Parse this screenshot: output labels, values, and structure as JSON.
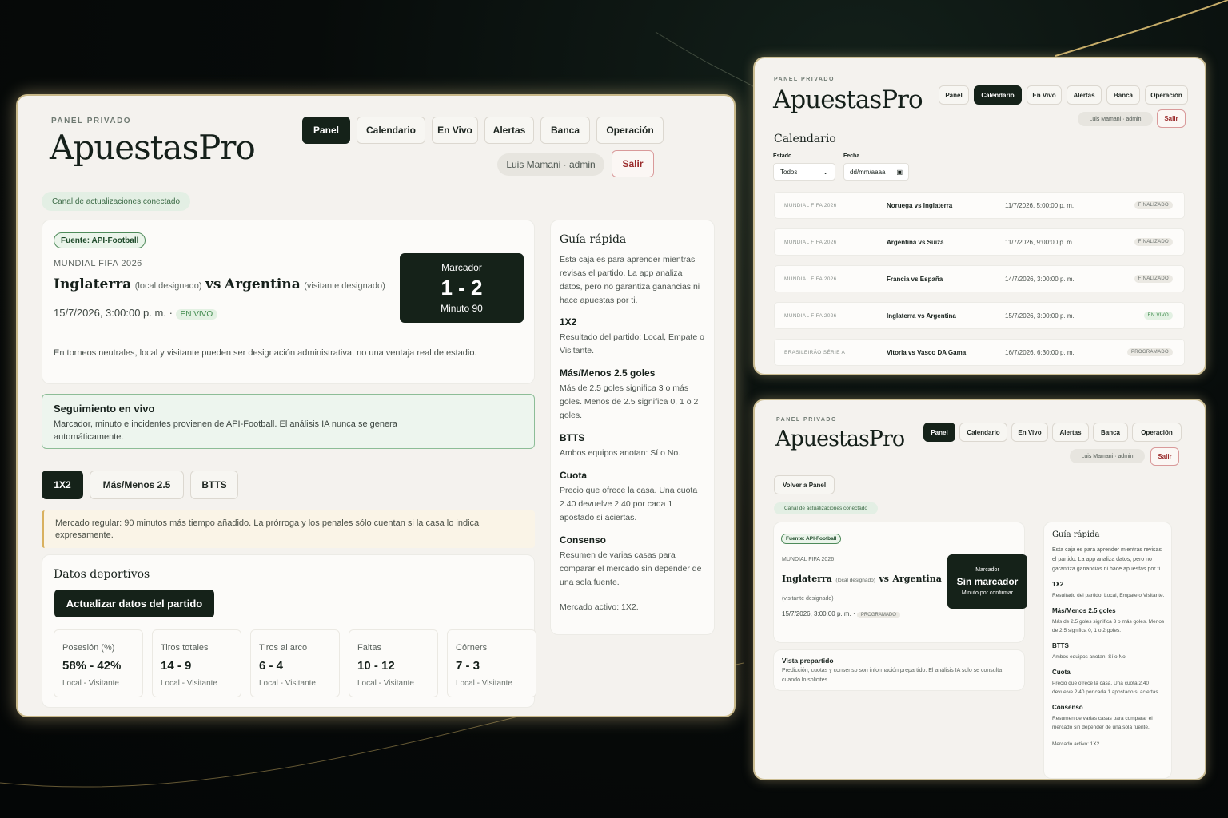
{
  "main": {
    "eyebrow": "PANEL PRIVADO",
    "brand": "ApuestasPro",
    "nav": [
      "Panel",
      "Calendario",
      "En Vivo",
      "Alertas",
      "Banca",
      "Operación"
    ],
    "user": "Luis Mamani · admin",
    "logout": "Salir",
    "status": "Canal de actualizaciones conectado",
    "source": "Fuente: API-Football",
    "competition": "MUNDIAL FIFA 2026",
    "home": "Inglaterra",
    "home_note": "(local designado)",
    "vs": "vs",
    "away": "Argentina",
    "away_note": "(visitante designado)",
    "datetime": "15/7/2026, 3:00:00 p. m.",
    "sep": "·",
    "state": "EN VIVO",
    "score_label": "Marcador",
    "score": "1 - 2",
    "minute": "Minuto 90",
    "neutral_note": "En torneos neutrales, local y visitante pueden ser designación administrativa, no una ventaja real de estadio.",
    "live_title": "Seguimiento en vivo",
    "live_text": "Marcador, minuto e incidentes provienen de API-Football. El análisis IA nunca se genera automáticamente.",
    "markets": [
      "1X2",
      "Más/Menos 2.5",
      "BTTS"
    ],
    "market_note": "Mercado regular: 90 minutos más tiempo añadido. La prórroga y los penales sólo cuentan si la casa lo indica expresamente.",
    "sports_title": "Datos deportivos",
    "update_btn": "Actualizar datos del partido",
    "stats": [
      {
        "label": "Posesión (%)",
        "value": "58% - 42%",
        "sub": "Local - Visitante"
      },
      {
        "label": "Tiros totales",
        "value": "14 - 9",
        "sub": "Local - Visitante"
      },
      {
        "label": "Tiros al arco",
        "value": "6 - 4",
        "sub": "Local - Visitante"
      },
      {
        "label": "Faltas",
        "value": "10 - 12",
        "sub": "Local - Visitante"
      },
      {
        "label": "Córners",
        "value": "7 - 3",
        "sub": "Local - Visitante"
      }
    ],
    "guide": {
      "title": "Guía rápida",
      "intro": "Esta caja es para aprender mientras revisas el partido. La app analiza datos, pero no garantiza ganancias ni hace apuestas por ti.",
      "items": [
        {
          "h": "1X2",
          "t": "Resultado del partido: Local, Empate o Visitante."
        },
        {
          "h": "Más/Menos 2.5 goles",
          "t": "Más de 2.5 goles significa 3 o más goles. Menos de 2.5 significa 0, 1 o 2 goles."
        },
        {
          "h": "BTTS",
          "t": "Ambos equipos anotan: Sí o No."
        },
        {
          "h": "Cuota",
          "t": "Precio que ofrece la casa. Una cuota 2.40 devuelve 2.40 por cada 1 apostado si aciertas."
        },
        {
          "h": "Consenso",
          "t": "Resumen de varias casas para comparar el mercado sin depender de una sola fuente."
        }
      ],
      "active": "Mercado activo: 1X2."
    }
  },
  "calendar": {
    "eyebrow": "PANEL PRIVADO",
    "brand": "ApuestasPro",
    "nav": [
      "Panel",
      "Calendario",
      "En Vivo",
      "Alertas",
      "Banca",
      "Operación"
    ],
    "user": "Luis Mamani · admin",
    "logout": "Salir",
    "title": "Calendario",
    "state_label": "Estado",
    "state_value": "Todos",
    "date_label": "Fecha",
    "date_placeholder": "dd/mm/aaaa",
    "rows": [
      {
        "comp": "MUNDIAL FIFA 2026",
        "match": "Noruega vs Inglaterra",
        "date": "11/7/2026, 5:00:00 p. m.",
        "status": "FINALIZADO"
      },
      {
        "comp": "MUNDIAL FIFA 2026",
        "match": "Argentina vs Suiza",
        "date": "11/7/2026, 9:00:00 p. m.",
        "status": "FINALIZADO"
      },
      {
        "comp": "MUNDIAL FIFA 2026",
        "match": "Francia vs España",
        "date": "14/7/2026, 3:00:00 p. m.",
        "status": "FINALIZADO"
      },
      {
        "comp": "MUNDIAL FIFA 2026",
        "match": "Inglaterra vs Argentina",
        "date": "15/7/2026, 3:00:00 p. m.",
        "status": "EN VIVO"
      },
      {
        "comp": "BRASILEIRÃO SÉRIE A",
        "match": "Vitoria vs Vasco DA Gama",
        "date": "16/7/2026, 6:30:00 p. m.",
        "status": "PROGRAMADO"
      }
    ]
  },
  "detail": {
    "eyebrow": "PANEL PRIVADO",
    "brand": "ApuestasPro",
    "nav": [
      "Panel",
      "Calendario",
      "En Vivo",
      "Alertas",
      "Banca",
      "Operación"
    ],
    "user": "Luis Mamani · admin",
    "logout": "Salir",
    "back": "Volver a Panel",
    "status": "Canal de actualizaciones conectado",
    "source": "Fuente: API-Football",
    "competition": "MUNDIAL FIFA 2026",
    "home": "Inglaterra",
    "home_note": "(local designado)",
    "vs": "vs",
    "away": "Argentina",
    "away_note": "(visitante designado)",
    "datetime": "15/7/2026, 3:00:00 p. m.",
    "sep": "·",
    "state": "PROGRAMADO",
    "score_label": "Marcador",
    "score": "Sin marcador",
    "minute": "Minuto por confirmar",
    "pre_title": "Vista prepartido",
    "pre_text": "Predicción, cuotas y consenso son información prepartido. El análisis IA solo se consulta cuando lo solicites.",
    "guide": {
      "title": "Guía rápida",
      "intro": "Esta caja es para aprender mientras revisas el partido. La app analiza datos, pero no garantiza ganancias ni hace apuestas por ti.",
      "items": [
        {
          "h": "1X2",
          "t": "Resultado del partido: Local, Empate o Visitante."
        },
        {
          "h": "Más/Menos 2.5 goles",
          "t": "Más de 2.5 goles significa 3 o más goles. Menos de 2.5 significa 0, 1 o 2 goles."
        },
        {
          "h": "BTTS",
          "t": "Ambos equipos anotan: Sí o No."
        },
        {
          "h": "Cuota",
          "t": "Precio que ofrece la casa. Una cuota 2.40 devuelve 2.40 por cada 1 apostado si aciertas."
        },
        {
          "h": "Consenso",
          "t": "Resumen de varias casas para comparar el mercado sin depender de una sola fuente."
        }
      ],
      "active": "Mercado activo: 1X2."
    }
  }
}
